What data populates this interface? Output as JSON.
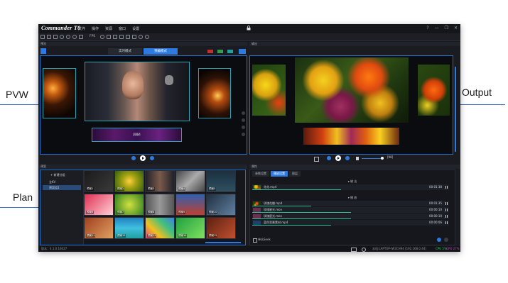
{
  "annotations": {
    "pvw": "PVW",
    "output": "Output",
    "plan": "Plan"
  },
  "app": {
    "logo": "Commander T0",
    "menu": [
      "文件",
      "操作",
      "资源",
      "窗口",
      "设置"
    ],
    "window_controls": [
      "?",
      "—",
      "❐",
      "✕"
    ]
  },
  "toolbar": {
    "fps_label": "FPS"
  },
  "preview_panel": {
    "header": "预览",
    "tabs": [
      "实时模式",
      "预编模式"
    ],
    "active_tab": 1,
    "subtitle": "屏幕4"
  },
  "output_panel": {
    "header": "输出",
    "monitor_label": "[98]"
  },
  "plan_panel": {
    "header": "预案",
    "new_group_button": "+ 新建分组",
    "tree": [
      "全KV",
      "预案组1"
    ],
    "thumbnails": [
      "预案1",
      "预案2",
      "预案3",
      "预案4",
      "预案5",
      "预案6",
      "预案7",
      "预案8",
      "预案9",
      "预案10",
      "预案11",
      "预案12",
      "预案13",
      "预案14",
      "预案15",
      "预案16",
      "预案17",
      "预案18"
    ]
  },
  "props_panel": {
    "header": "属性",
    "tabs": [
      "参数设置",
      "播放设置",
      "图层"
    ],
    "active_tab": 1,
    "section_a": "▾ 输 出",
    "section_b": "▾ 播 放",
    "rows_a": [
      {
        "name": "花花.mp4",
        "time": "00:01:38",
        "progress": 0.45
      }
    ],
    "rows_b": [
      {
        "name": "玫瑰花瓣.mp4",
        "time": "00:01:35",
        "progress": 0.3
      },
      {
        "name": "玫瑰星光.mov",
        "time": "00:00:10",
        "progress": 0.5
      },
      {
        "name": "玫瑰星光.mov",
        "time": "00:00:10",
        "progress": 0.5
      },
      {
        "name": "蓝色背景素材.mp4",
        "time": "00:00:06",
        "progress": 0.4
      }
    ],
    "seek_label": "单击Seek"
  },
  "statusbar": {
    "version": "版本：4.1.0.16027",
    "host": "本机:LAPTOP-IW3CH94 (192.168.0.44)",
    "cpu": "CPU 5%",
    "gpu": "GPU 27%"
  },
  "colors": {
    "accent": "#2d7be0",
    "teal": "#25a4b8",
    "frame_bg": "#1a1c22"
  }
}
